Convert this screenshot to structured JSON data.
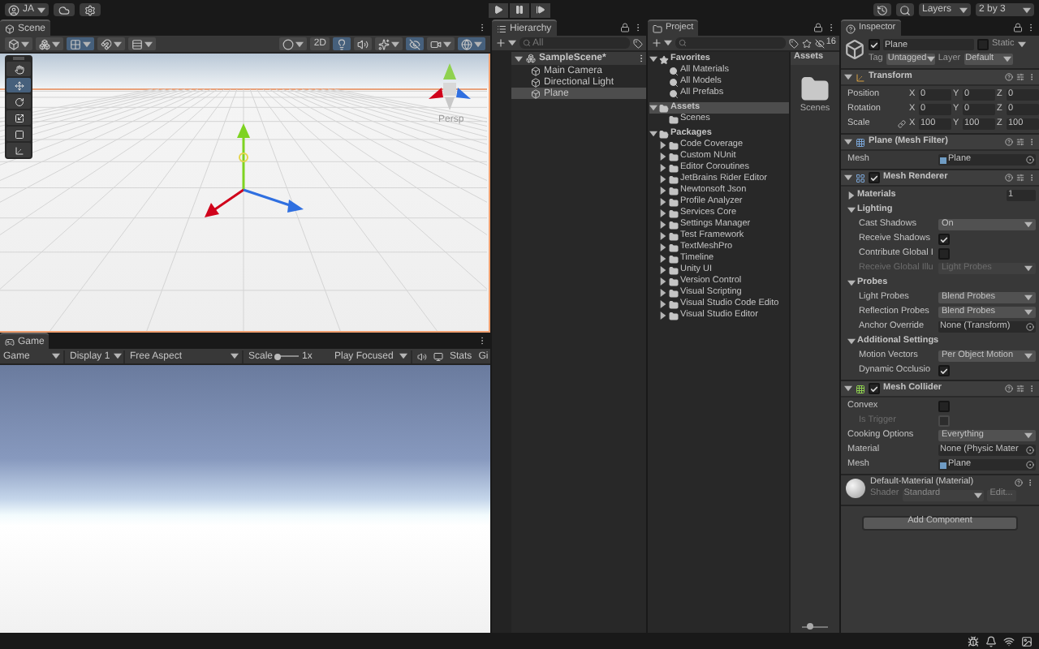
{
  "top_bar": {
    "account": "JA",
    "layers": "Layers",
    "layout": "2 by 3"
  },
  "scene": {
    "tab": "Scene",
    "toolbar_left": [
      {
        "kind": "render_mode",
        "on": false,
        "caret": true
      },
      {
        "kind": "pivot",
        "on": false,
        "caret": true
      },
      {
        "kind": "grid_snap",
        "on": true,
        "caret": true
      },
      {
        "kind": "increment_snap",
        "on": false,
        "caret": true
      },
      {
        "kind": "grid_settings",
        "on": false,
        "caret": true
      }
    ],
    "toolbar_right": [
      {
        "kind": "shading",
        "on": false,
        "caret": true
      },
      {
        "kind": "toggle_2d",
        "label": "2D",
        "on": false,
        "caret": false
      },
      {
        "kind": "lighting",
        "on": true,
        "caret": false
      },
      {
        "kind": "audio",
        "on": false,
        "caret": false
      },
      {
        "kind": "effects",
        "on": false,
        "caret": true
      },
      {
        "kind": "visibility",
        "on": true,
        "caret": false
      },
      {
        "kind": "camera",
        "on": false,
        "caret": true
      },
      {
        "kind": "gizmos",
        "on": true,
        "caret": true
      }
    ],
    "tools": [
      {
        "kind": "hand",
        "selected": false
      },
      {
        "kind": "move",
        "selected": true
      },
      {
        "kind": "rotate",
        "selected": false
      },
      {
        "kind": "scale",
        "selected": false
      },
      {
        "kind": "rect",
        "selected": false
      },
      {
        "kind": "transform",
        "selected": false
      }
    ],
    "camera_label": "Persp"
  },
  "game": {
    "tab": "Game",
    "view": "Game",
    "display": "Display 1",
    "aspect": "Free Aspect",
    "scale_label": "Scale",
    "scale": {
      "level": 0.1
    },
    "scale_value": "1x",
    "play_mode": "Play Focused",
    "stats": "Stats",
    "gizmos": "Gi"
  },
  "hierarchy": {
    "tab": "Hierarchy",
    "search_placeholder": "All",
    "scene": {
      "name": "SampleScene*",
      "expanded": true,
      "children": [
        {
          "name": "Main Camera",
          "selected": false
        },
        {
          "name": "Directional Light",
          "selected": false
        },
        {
          "name": "Plane",
          "selected": true
        }
      ]
    }
  },
  "project": {
    "tab": "Project",
    "hidden_count": "16",
    "tree": [
      {
        "kind": "favorites",
        "label": "Favorites",
        "expanded": true,
        "selected": false,
        "children": [
          {
            "kind": "search",
            "label": "All Materials",
            "selected": false
          },
          {
            "kind": "search",
            "label": "All Models",
            "selected": false
          },
          {
            "kind": "search",
            "label": "All Prefabs",
            "selected": false
          }
        ]
      },
      {
        "kind": "folder",
        "label": "Assets",
        "expanded": true,
        "selected": true,
        "children": [
          {
            "kind": "folder",
            "label": "Scenes",
            "selected": false
          }
        ]
      },
      {
        "kind": "folder",
        "label": "Packages",
        "expanded": true,
        "selected": false,
        "children": [
          {
            "kind": "folder",
            "label": "Code Coverage",
            "expanded": false,
            "selected": false
          },
          {
            "kind": "folder",
            "label": "Custom NUnit",
            "expanded": false,
            "selected": false
          },
          {
            "kind": "folder",
            "label": "Editor Coroutines",
            "expanded": false,
            "selected": false
          },
          {
            "kind": "folder",
            "label": "JetBrains Rider Editor",
            "expanded": false,
            "selected": false
          },
          {
            "kind": "folder",
            "label": "Newtonsoft Json",
            "expanded": false,
            "selected": false
          },
          {
            "kind": "folder",
            "label": "Profile Analyzer",
            "expanded": false,
            "selected": false
          },
          {
            "kind": "folder",
            "label": "Services Core",
            "expanded": false,
            "selected": false
          },
          {
            "kind": "folder",
            "label": "Settings Manager",
            "expanded": false,
            "selected": false
          },
          {
            "kind": "folder",
            "label": "Test Framework",
            "expanded": false,
            "selected": false
          },
          {
            "kind": "folder",
            "label": "TextMeshPro",
            "expanded": false,
            "selected": false
          },
          {
            "kind": "folder",
            "label": "Timeline",
            "expanded": false,
            "selected": false
          },
          {
            "kind": "folder",
            "label": "Unity UI",
            "expanded": false,
            "selected": false
          },
          {
            "kind": "folder",
            "label": "Version Control",
            "expanded": false,
            "selected": false
          },
          {
            "kind": "folder",
            "label": "Visual Scripting",
            "expanded": false,
            "selected": false
          },
          {
            "kind": "folder",
            "label": "Visual Studio Code Edito",
            "expanded": false,
            "selected": false
          },
          {
            "kind": "folder",
            "label": "Visual Studio Editor",
            "expanded": false,
            "selected": false
          }
        ]
      }
    ],
    "breadcrumb": "Assets",
    "items": [
      {
        "kind": "folder",
        "name": "Scenes"
      }
    ],
    "icon_size": {
      "level": 0.3
    }
  },
  "inspector": {
    "tab": "Inspector",
    "object": {
      "active": true,
      "name": "Plane",
      "static_label": "Static",
      "static": false,
      "tag_label": "Tag",
      "tag": "Untagged",
      "layer_label": "Layer",
      "layer": "Default"
    },
    "components": [
      {
        "kind": "transform",
        "title": "Transform",
        "expanded": true,
        "rows": [
          {
            "kind": "vector3",
            "label": "Position",
            "linked": false,
            "values": [
              {
                "axis": "X",
                "value": "0"
              },
              {
                "axis": "Y",
                "value": "0"
              },
              {
                "axis": "Z",
                "value": "0"
              }
            ]
          },
          {
            "kind": "vector3",
            "label": "Rotation",
            "linked": false,
            "values": [
              {
                "axis": "X",
                "value": "0"
              },
              {
                "axis": "Y",
                "value": "0"
              },
              {
                "axis": "Z",
                "value": "0"
              }
            ]
          },
          {
            "kind": "vector3",
            "label": "Scale",
            "linked": true,
            "values": [
              {
                "axis": "X",
                "value": "100"
              },
              {
                "axis": "Y",
                "value": "100"
              },
              {
                "axis": "Z",
                "value": "100"
              }
            ]
          }
        ]
      },
      {
        "kind": "mesh_filter",
        "title": "Plane (Mesh Filter)",
        "expanded": true,
        "rows": [
          {
            "kind": "object",
            "label": "Mesh",
            "value": "Plane",
            "asset": true
          }
        ]
      },
      {
        "kind": "mesh_renderer",
        "title": "Mesh Renderer",
        "enabled": true,
        "expanded": true,
        "rows": [
          {
            "kind": "count",
            "label": "Materials",
            "expanded": false,
            "value": "1"
          },
          {
            "kind": "section",
            "label": "Lighting",
            "expanded": true,
            "children": [
              {
                "kind": "dropdown",
                "label": "Cast Shadows",
                "value": "On",
                "disabled": false
              },
              {
                "kind": "checkbox",
                "label": "Receive Shadows",
                "checked": true,
                "disabled": false
              },
              {
                "kind": "checkbox",
                "label": "Contribute Global I",
                "checked": false,
                "disabled": false
              },
              {
                "kind": "dropdown",
                "label": "Receive Global Illu",
                "value": "Light Probes",
                "disabled": true
              }
            ]
          },
          {
            "kind": "section",
            "label": "Probes",
            "expanded": true,
            "children": [
              {
                "kind": "dropdown",
                "label": "Light Probes",
                "value": "Blend Probes",
                "disabled": false
              },
              {
                "kind": "dropdown",
                "label": "Reflection Probes",
                "value": "Blend Probes",
                "disabled": false
              },
              {
                "kind": "object",
                "label": "Anchor Override",
                "value": "None (Transform)",
                "asset": false
              }
            ]
          },
          {
            "kind": "section",
            "label": "Additional Settings",
            "expanded": true,
            "children": [
              {
                "kind": "dropdown",
                "label": "Motion Vectors",
                "value": "Per Object Motion",
                "disabled": false
              },
              {
                "kind": "checkbox",
                "label": "Dynamic Occlusio",
                "checked": true,
                "disabled": false
              }
            ]
          }
        ]
      },
      {
        "kind": "mesh_collider",
        "title": "Mesh Collider",
        "enabled": true,
        "expanded": true,
        "rows": [
          {
            "kind": "checkbox",
            "label": "Convex",
            "checked": false,
            "disabled": false,
            "children": [
              {
                "kind": "checkbox",
                "label": "Is Trigger",
                "checked": false,
                "disabled": true
              }
            ]
          },
          {
            "kind": "dropdown",
            "label": "Cooking Options",
            "value": "Everything",
            "disabled": false
          },
          {
            "kind": "object",
            "label": "Material",
            "value": "None (Physic Mater",
            "asset": false
          },
          {
            "kind": "object",
            "label": "Mesh",
            "value": "Plane",
            "asset": true
          }
        ]
      }
    ],
    "material": {
      "name": "Default-Material (Material)",
      "shader_label": "Shader",
      "shader": "Standard",
      "edit": "Edit..."
    },
    "add_component": "Add Component"
  }
}
